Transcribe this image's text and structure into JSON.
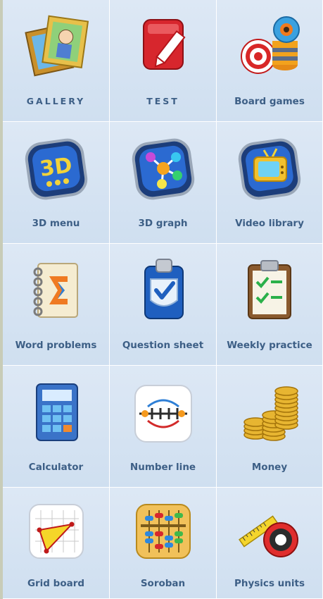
{
  "tiles": [
    {
      "label": "GALLERY",
      "icon": "gallery-icon"
    },
    {
      "label": "TEST",
      "icon": "test-icon"
    },
    {
      "label": "Board games",
      "icon": "board-games-icon"
    },
    {
      "label": "3D menu",
      "icon": "3d-menu-icon"
    },
    {
      "label": "3D graph",
      "icon": "3d-graph-icon"
    },
    {
      "label": "Video library",
      "icon": "video-library-icon"
    },
    {
      "label": "Word problems",
      "icon": "word-problems-icon"
    },
    {
      "label": "Question sheet",
      "icon": "question-sheet-icon"
    },
    {
      "label": "Weekly practice",
      "icon": "weekly-practice-icon"
    },
    {
      "label": "Calculator",
      "icon": "calculator-icon"
    },
    {
      "label": "Number line",
      "icon": "number-line-icon"
    },
    {
      "label": "Money",
      "icon": "money-icon"
    },
    {
      "label": "Grid board",
      "icon": "grid-board-icon"
    },
    {
      "label": "Soroban",
      "icon": "soroban-icon"
    },
    {
      "label": "Physics units",
      "icon": "physics-units-icon"
    }
  ],
  "colors": {
    "label": "#3d5f86",
    "tile_bg": "#d6e4f2",
    "border": "#ffffff"
  }
}
